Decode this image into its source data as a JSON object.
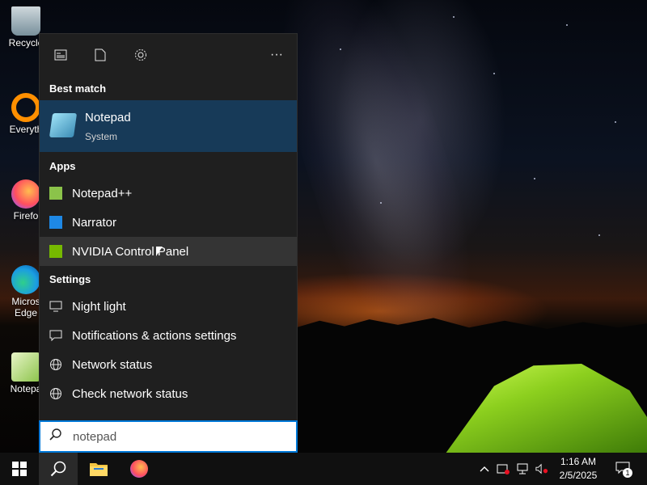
{
  "desktop_icons": [
    {
      "label": "Recycle",
      "icon": "recycle-bin-icon"
    },
    {
      "label": "Everyth",
      "icon": "everything-search-icon"
    },
    {
      "label": "Firefo",
      "icon": "firefox-icon"
    },
    {
      "label": "Micros",
      "label2": "Edge",
      "icon": "edge-icon"
    },
    {
      "label": "Notepa",
      "icon": "notepadpp-icon"
    }
  ],
  "start_panel": {
    "toolbar_icons": [
      "news-icon",
      "document-icon",
      "gear-icon",
      "more-icon"
    ],
    "more_label": "···",
    "best_match_heading": "Best match",
    "best_match": {
      "title": "Notepad",
      "subtitle": "System",
      "icon": "notepad-icon"
    },
    "apps_heading": "Apps",
    "apps": [
      {
        "label": "Notepad++",
        "icon": "notepadpp-icon"
      },
      {
        "label": "Narrator",
        "icon": "narrator-icon"
      },
      {
        "label": "NVIDIA Control Panel",
        "icon": "nvidia-icon"
      }
    ],
    "settings_heading": "Settings",
    "settings": [
      {
        "label": "Night light",
        "icon": "monitor-icon"
      },
      {
        "label": "Notifications & actions settings",
        "icon": "notification-icon"
      },
      {
        "label": "Network status",
        "icon": "globe-icon"
      },
      {
        "label": "Check network status",
        "icon": "globe-icon"
      }
    ]
  },
  "search": {
    "value": "notepad",
    "icon": "search-icon"
  },
  "taskbar": {
    "clock_time": "1:16 AM",
    "clock_date": "2/5/2025",
    "notification_count": "1",
    "accent_color": "#0078d7"
  }
}
